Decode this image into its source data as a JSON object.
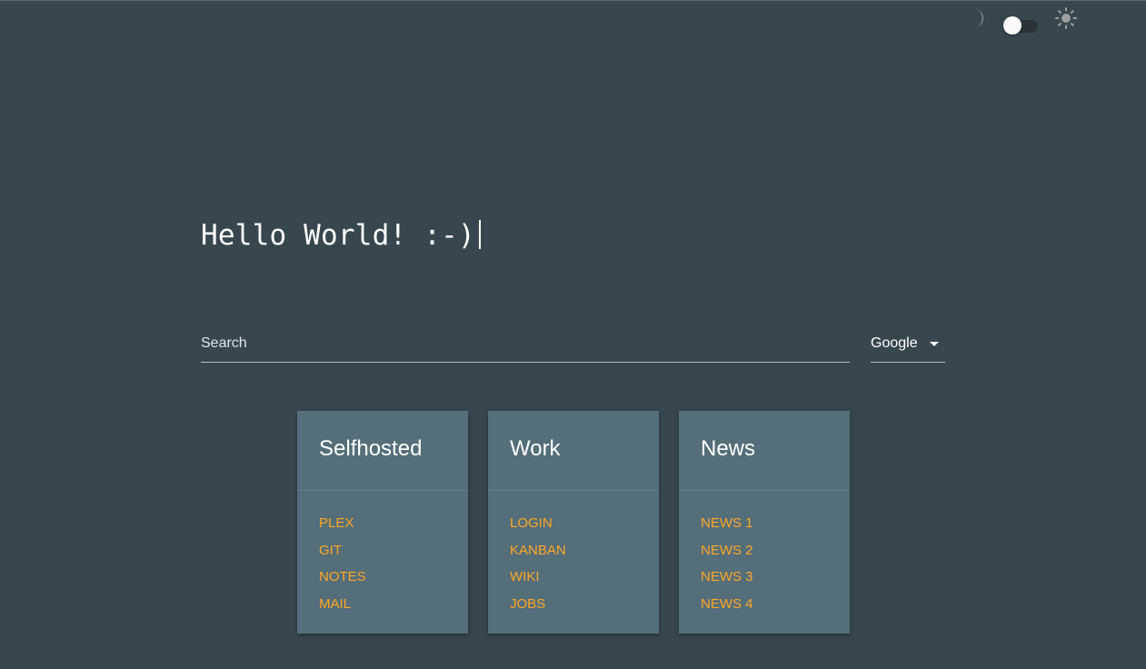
{
  "theme": {
    "dark_icon": "moon-icon",
    "light_icon": "sun-icon",
    "toggle_state": "dark"
  },
  "greeting": {
    "text": "Hello World! :-)"
  },
  "search": {
    "placeholder": "Search",
    "engine": "Google"
  },
  "colors": {
    "background": "#37474f",
    "card": "#546e7a",
    "link": "#ffa726",
    "text": "#ffffff"
  },
  "cards": [
    {
      "title": "Selfhosted",
      "links": [
        "PLEX",
        "GIT",
        "NOTES",
        "MAIL"
      ]
    },
    {
      "title": "Work",
      "links": [
        "LOGIN",
        "KANBAN",
        "WIKI",
        "JOBS"
      ]
    },
    {
      "title": "News",
      "links": [
        "NEWS 1",
        "NEWS 2",
        "NEWS 3",
        "NEWS 4"
      ]
    }
  ]
}
